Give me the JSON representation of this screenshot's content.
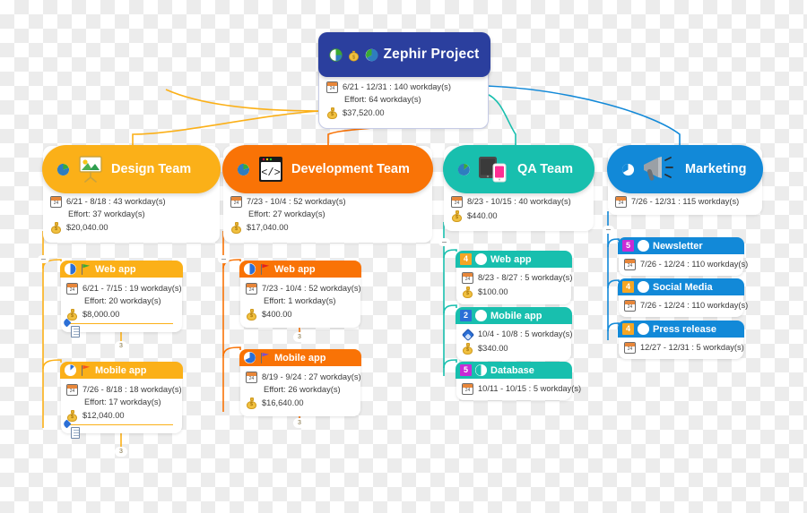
{
  "diagram": {
    "type": "project-mindmap",
    "background": "transparent-checkerboard"
  },
  "root": {
    "title": "Zephir Project",
    "color": "#2b3f9e",
    "icons": [
      "progress-pie-icon",
      "money-bag-icon",
      "chart-pie-icon"
    ],
    "dates": "6/21 - 12/31 : 140 workday(s)",
    "effort": "Effort: 64 workday(s)",
    "cost": "$37,520.00",
    "calendar_day": "24"
  },
  "teams": [
    {
      "key": "design",
      "title": "Design Team",
      "color": "#fbb018",
      "icon": "image-easel-icon",
      "dates": "6/21 - 8/18 : 43 workday(s)",
      "effort": "Effort: 37 workday(s)",
      "cost": "$20,040.00",
      "children": [
        {
          "title": "Web app",
          "badge": "",
          "badge_color": "#2b6fd6",
          "glyph": "half-pie-icon",
          "flag": "green-flag-icon",
          "flag_color": "#3aaa35",
          "header_color": "#fbb018",
          "dates": "6/21 - 7/15 : 19 workday(s)",
          "effort": "Effort: 20 workday(s)",
          "cost": "$8,000.00",
          "has_note": true,
          "tick": "3"
        },
        {
          "title": "Mobile app",
          "badge": "",
          "badge_color": "#2b6fd6",
          "glyph": "quarter-pie-icon",
          "flag": "orange-flag-icon",
          "flag_color": "#f4511e",
          "header_color": "#fbb018",
          "dates": "7/26 - 8/18 : 18 workday(s)",
          "effort": "Effort: 17 workday(s)",
          "cost": "$12,040.00",
          "has_note": true,
          "tick": "3"
        }
      ]
    },
    {
      "key": "development",
      "title": "Development Team",
      "color": "#f97306",
      "icon": "code-window-icon",
      "dates": "7/23 - 10/4 : 52 workday(s)",
      "effort": "Effort: 27 workday(s)",
      "cost": "$17,040.00",
      "children": [
        {
          "title": "Web app",
          "badge": "",
          "badge_color": "#2b6fd6",
          "glyph": "half-pie-icon",
          "flag": "red-flag-icon",
          "flag_color": "#e02020",
          "header_color": "#f97306",
          "dates": "7/23 - 10/4 : 52 workday(s)",
          "effort": "Effort: 1 workday(s)",
          "cost": "$400.00",
          "has_note": false,
          "tick": "3"
        },
        {
          "title": "Mobile app",
          "badge": "",
          "badge_color": "#2b6fd6",
          "glyph": "pie-icon",
          "flag": "purple-flag-icon",
          "flag_color": "#7b4fd0",
          "header_color": "#f97306",
          "dates": "8/19 - 9/24 : 27 workday(s)",
          "effort": "Effort: 26 workday(s)",
          "cost": "$16,640.00",
          "has_note": false,
          "tick": "3"
        }
      ]
    },
    {
      "key": "qa",
      "title": "QA Team",
      "color": "#18bfae",
      "icon": "devices-icon",
      "dates": "8/23 - 10/15 : 40 workday(s)",
      "effort": "",
      "cost": "$440.00",
      "children": [
        {
          "title": "Web app",
          "badge": "4",
          "badge_color": "#f5a623",
          "glyph": "circle-empty-icon",
          "header_color": "#18bfae",
          "dates": "8/23 - 8/27 : 5 workday(s)",
          "cost": "$100.00",
          "date_icon": "calendar-icon"
        },
        {
          "title": "Mobile app",
          "badge": "2",
          "badge_color": "#2b6fd6",
          "glyph": "moon-icon",
          "header_color": "#18bfae",
          "dates": "10/4 - 10/8 : 5 workday(s)",
          "cost": "$340.00",
          "date_icon": "milestone-diamond-icon"
        },
        {
          "title": "Database",
          "badge": "5",
          "badge_color": "#c82bd6",
          "glyph": "half-circle-icon",
          "header_color": "#18bfae",
          "dates": "10/11 - 10/15 : 5 workday(s)",
          "cost": "",
          "date_icon": "calendar-icon"
        }
      ]
    },
    {
      "key": "marketing",
      "title": "Marketing",
      "color": "#1289d8",
      "icon": "megaphone-icon",
      "dates": "7/26 - 12/31 : 115 workday(s)",
      "effort": "",
      "cost": "",
      "children": [
        {
          "title": "Newsletter",
          "badge": "5",
          "badge_color": "#c82bd6",
          "glyph": "circle-empty-icon",
          "header_color": "#1289d8",
          "dates": "7/26 - 12/24 : 110 workday(s)",
          "cost": "",
          "date_icon": "calendar-icon"
        },
        {
          "title": "Social Media",
          "badge": "4",
          "badge_color": "#f5a623",
          "glyph": "circle-empty-icon",
          "header_color": "#1289d8",
          "dates": "7/26 - 12/24 : 110 workday(s)",
          "cost": "",
          "date_icon": "calendar-icon"
        },
        {
          "title": "Press release",
          "badge": "4",
          "badge_color": "#f5a623",
          "glyph": "circle-empty-icon",
          "header_color": "#1289d8",
          "dates": "12/27 - 12/31 : 5 workday(s)",
          "cost": "",
          "date_icon": "calendar-icon"
        }
      ]
    }
  ]
}
